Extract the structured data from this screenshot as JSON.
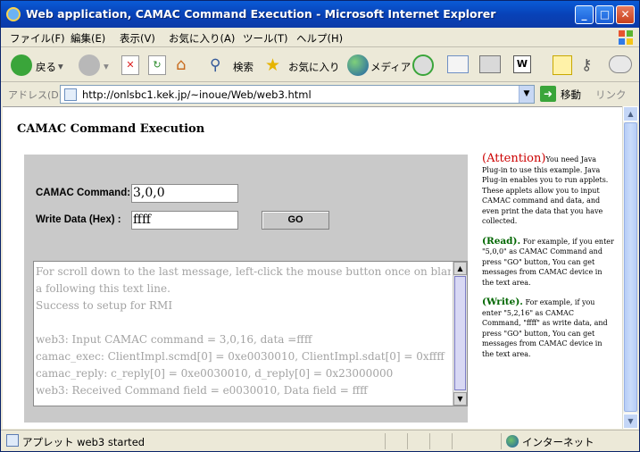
{
  "window": {
    "title": "Web application, CAMAC Command Execution - Microsoft Internet Explorer",
    "minimize": "_",
    "maximize": "□",
    "close": "✕"
  },
  "menu": [
    "ファイル(F)",
    "編集(E)",
    "表示(V)",
    "お気に入り(A)",
    "ツール(T)",
    "ヘルプ(H)"
  ],
  "toolbar": {
    "back": "戻る",
    "search": "検索",
    "favorites": "お気に入り",
    "media": "メディア"
  },
  "address": {
    "label": "アドレス(D)",
    "url": "http://onlsbc1.kek.jp/~inoue/Web/web3.html",
    "go": "移動",
    "links": "リンク"
  },
  "page": {
    "title": "CAMAC Command Execution"
  },
  "applet": {
    "command_label": "CAMAC Command:",
    "command_value": "3,0,0",
    "write_label": "Write Data (Hex) :",
    "write_value": "ffff",
    "go_label": "GO",
    "output_lines": [
      "For scroll down to the last message, left-click the mouse button once on blank area",
      "a following this text line.",
      "Success to setup for RMI",
      "",
      "web3:  Input CAMAC command = 3,0,16,    data =ffff",
      "camac_exec: ClientImpl.scmd[0] = 0xe0030010, ClientImpl.sdat[0] = 0xffff",
      "camac_reply: c_reply[0] = 0xe0030010, d_reply[0] = 0x23000000",
      "web3:  Received Command field = e0030010,    Data field = ffff"
    ]
  },
  "sidebar": {
    "attention_head": "(Attention)",
    "attention_text": "You need Java Plug-in to use this example. Java Plug-in enables you to run applets.  These applets allow you to input CAMAC command and data, and even print the data that you have collected.",
    "read_head": "(Read).",
    "read_text": " For example, if you enter \"5,0,0\" as CAMAC Command and press \"GO\" button, You can get messages from CAMAC device in the text area.",
    "write_head": "(Write).",
    "write_text": " For example, if you enter \"5,2,16\" as CAMAC Command, \"ffff\" as write data, and press \"GO\" button, You can get messages from CAMAC device in the text area."
  },
  "status": {
    "text": "アプレット web3 started",
    "zone": "インターネット"
  },
  "colors": {
    "titlebar": "#0a5bd6",
    "attention": "#cc0000",
    "read_write_heads": "#006600",
    "applet_bg": "#c9c9c9"
  }
}
